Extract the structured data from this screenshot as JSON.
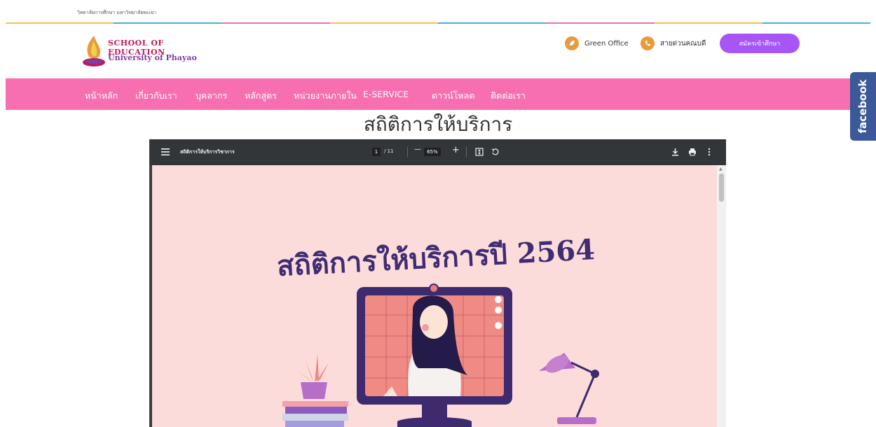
{
  "top_bar": {
    "site_text": "วิทยาลัยการศึกษา มหาวิทยาลัยพะเยา"
  },
  "stripe_colors": [
    "#f6c144",
    "#3db4d8",
    "#e86fb0",
    "#f6c144",
    "#3db4d8",
    "#e86fb0",
    "#f6c144",
    "#3db4d8"
  ],
  "logo": {
    "line1": "SCHOOL OF EDUCATION",
    "line2": "University of Phayao"
  },
  "header_links": [
    {
      "label": "Green Office",
      "icon": "leaf-icon"
    },
    {
      "label": "สายด่วนคณบดี",
      "icon": "phone-icon"
    }
  ],
  "apply_button": "สมัครเข้าศึกษา",
  "nav": {
    "items": [
      "หน้าหลัก",
      "เกี่ยวกับเรา",
      "บุคลากร",
      "หลักสูตร",
      "หน่วยงานภายใน",
      "E-SERVICE",
      "ดาวน์โหลด",
      "ติดต่อเรา"
    ]
  },
  "facebook_tab": "facebook",
  "page_heading": "สถิติการให้บริการ",
  "pdf_viewer": {
    "title": "สถิติการให้บริการวิชาการ",
    "current_page": "1",
    "total_pages": "/ 11",
    "zoom": "65%",
    "zoom_minus": "—",
    "zoom_plus": "+"
  },
  "pdf_page": {
    "title": "สถิติการให้บริการปี 2564"
  },
  "colors": {
    "nav_pink": "#f76fb0",
    "accent_purple": "#a855f7",
    "icon_orange": "#e89a3c",
    "facebook_blue": "#3b5998",
    "pdf_page_bg": "#fcdcda",
    "doc_title_purple": "#3f2c74"
  }
}
